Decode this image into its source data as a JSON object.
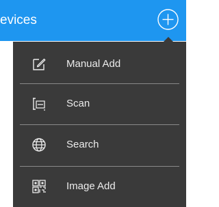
{
  "header": {
    "title": "evices",
    "background": "#1e96f0",
    "add_icon": "plus-circle-icon"
  },
  "menu": {
    "background": "#3a3a3a",
    "items": [
      {
        "label": "Manual Add",
        "icon": "edit-icon"
      },
      {
        "label": "Scan",
        "icon": "scan-icon"
      },
      {
        "label": "Search",
        "icon": "globe-icon"
      },
      {
        "label": "Image Add",
        "icon": "qr-code-icon"
      }
    ]
  }
}
